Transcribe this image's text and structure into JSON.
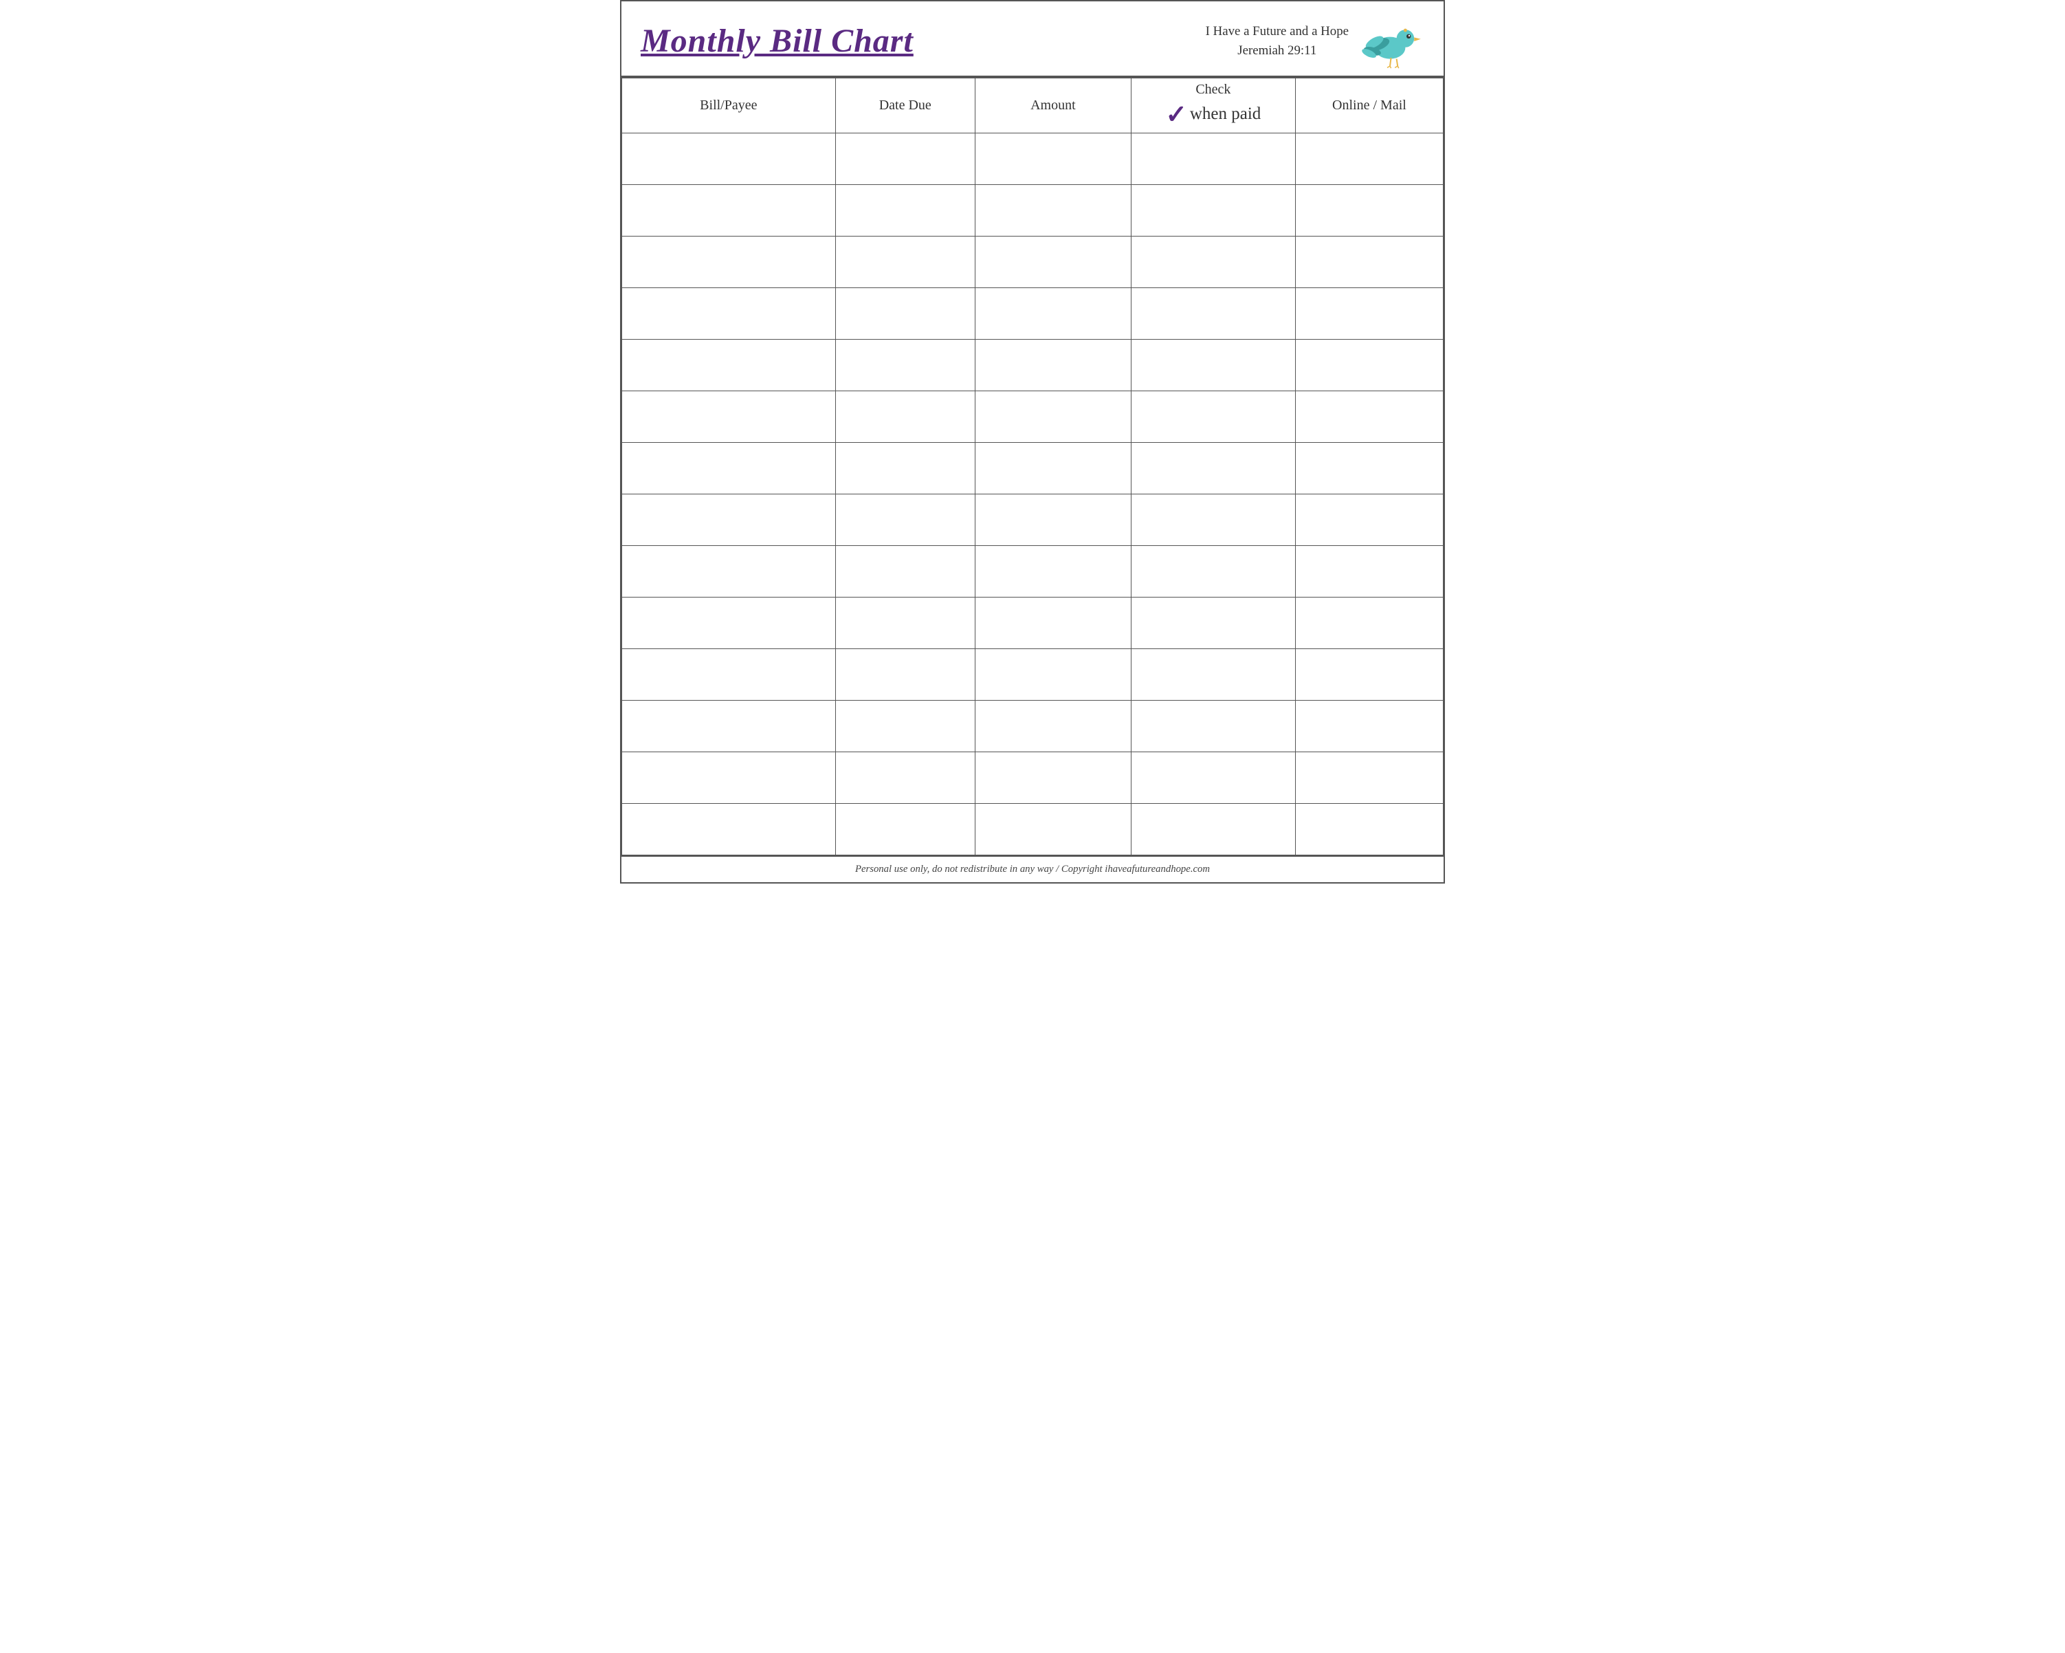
{
  "header": {
    "title": "Monthly Bill Chart",
    "tagline_line1": "I Have a Future and a Hope",
    "tagline_line2": "Jeremiah 29:11"
  },
  "table": {
    "columns": [
      {
        "key": "bill",
        "label": "Bill/Payee"
      },
      {
        "key": "date",
        "label": "Date Due"
      },
      {
        "key": "amount",
        "label": "Amount"
      },
      {
        "key": "check",
        "label_top": "Check",
        "label_bottom": "when paid"
      },
      {
        "key": "online",
        "label": "Online / Mail"
      }
    ],
    "row_count": 14
  },
  "footer": {
    "text": "Personal use only, do not redistribute in any way / Copyright ihaveafutureandhope.com"
  }
}
